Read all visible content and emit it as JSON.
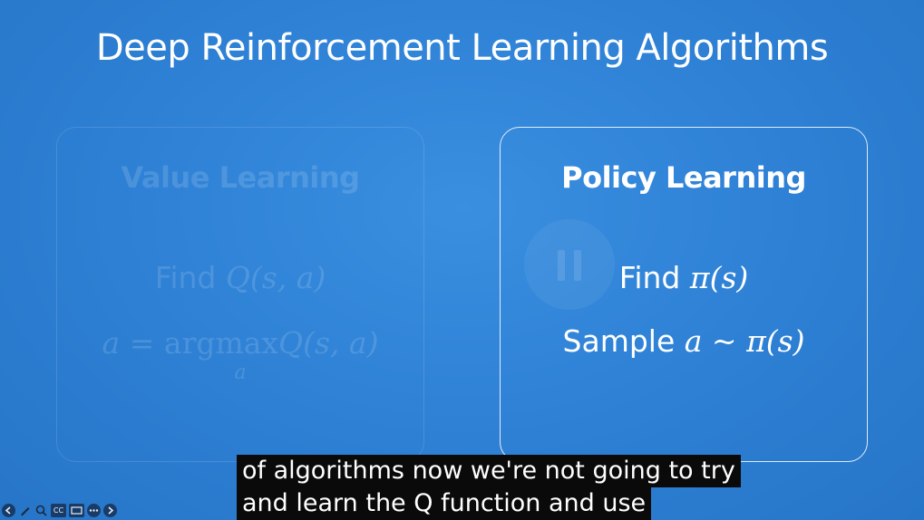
{
  "slide": {
    "title": "Deep Reinforcement Learning Algorithms"
  },
  "value_card": {
    "heading": "Value Learning",
    "find_word": "Find",
    "find_expr": "Q(s, a)",
    "eq_lhs": "a",
    "eq_sign": "=",
    "eq_op": "argmax",
    "eq_expr": "Q(s, a)",
    "eq_subscript": "a"
  },
  "policy_card": {
    "heading": "Policy Learning",
    "find_word": "Find",
    "find_expr": "π(s)",
    "sample_word": "Sample",
    "sample_expr": "a ~ π(s)"
  },
  "captions": {
    "line1": "of algorithms now we're not going to try",
    "line2": "and learn the Q function and use"
  },
  "player_controls": {
    "icons": [
      "back-icon",
      "pen-icon",
      "zoom-icon",
      "closed-captions-icon",
      "screen-icon",
      "more-options-icon",
      "next-icon"
    ],
    "cc_label": "CC"
  },
  "colors": {
    "background": "#2f82d6",
    "caption_background": "#0a0a0a",
    "text": "#ffffff"
  }
}
